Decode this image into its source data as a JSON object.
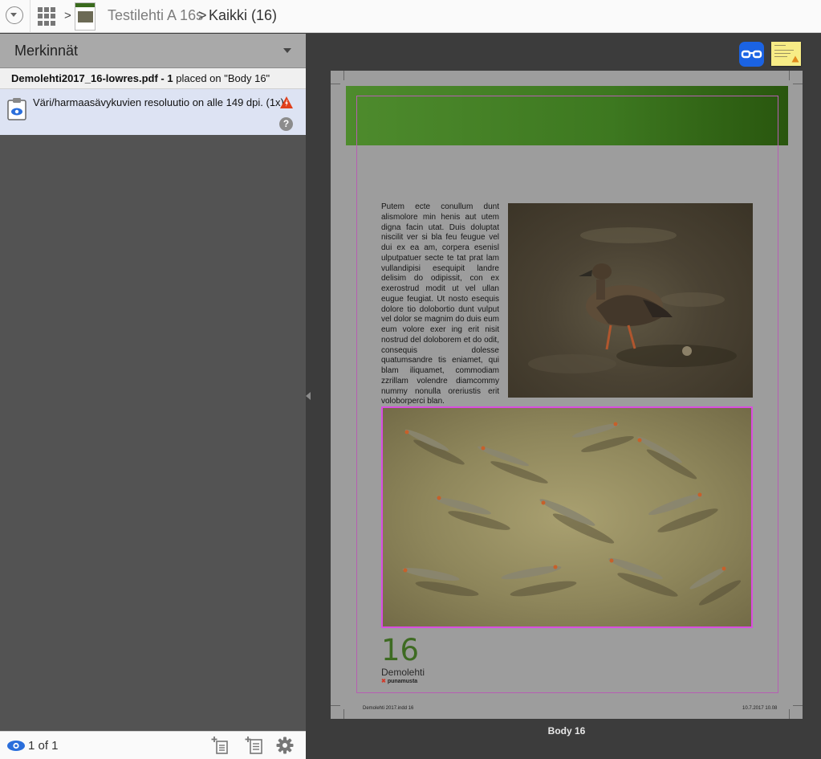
{
  "topbar": {
    "crumb_sep": ">",
    "document_title": "Testilehti A 16s",
    "page_crumb_sep": ">",
    "page_crumb": "Kaikki (16)"
  },
  "sidebar": {
    "panel_title": "Merkinnät",
    "file_row": {
      "filename": "Demolehti2017_16-lowres.pdf",
      "separator": "-",
      "count": "1",
      "placement": "placed on \"Body 16\""
    },
    "issue": {
      "text": "Väri/harmaasävykuvien resoluutio on alle 149 dpi.  (1x)",
      "severity_color": "#e0401c",
      "help_glyph": "?"
    },
    "bottom": {
      "pager": "1 of 1"
    }
  },
  "page": {
    "body_text": "Putem ecte conullum dunt alismolore min henis aut utem digna facin utat. Duis doluptat niscilit ver si bla feu feugue vel dui ex ea am, corpera esenisl ulputpatuer secte te tat prat lam vullandipisi esequipit landre delisim do odipissit, con ex exerostrud modit ut vel ullan eugue feugiat. Ut nosto esequis dolore tio dolobortio dunt vulput vel dolor se magnim do duis eum eum volore exer ing erit nisit nostrud del doloborem et do odit, consequis dolesse quatumsandre tis eniamet, qui blam iliquamet, commodiam zzrillam volendre diamcommy nummy nonulla oreriustis erit voloborperci blan.",
    "page_number": "16",
    "brand": "Demolehti",
    "logo_text": "punamusta",
    "slug_left": "Demolehti 2017.indd   16",
    "slug_right": "10.7.2017   10.08",
    "label": "Body 16",
    "accent_green": "#3d7820",
    "frame_color": "#d94de0"
  },
  "icons": {
    "menu": "chevron-down-circle-icon",
    "grid": "grid-icon",
    "clipboard": "clipboard-eye-icon",
    "warning": "warning-triangle-icon",
    "help": "help-circle-icon",
    "eye": "eye-icon",
    "add_page_before": "add-page-icon",
    "add_page_after": "add-page-list-icon",
    "settings": "gear-icon",
    "glasses": "glasses-icon",
    "note": "sticky-note-icon"
  }
}
